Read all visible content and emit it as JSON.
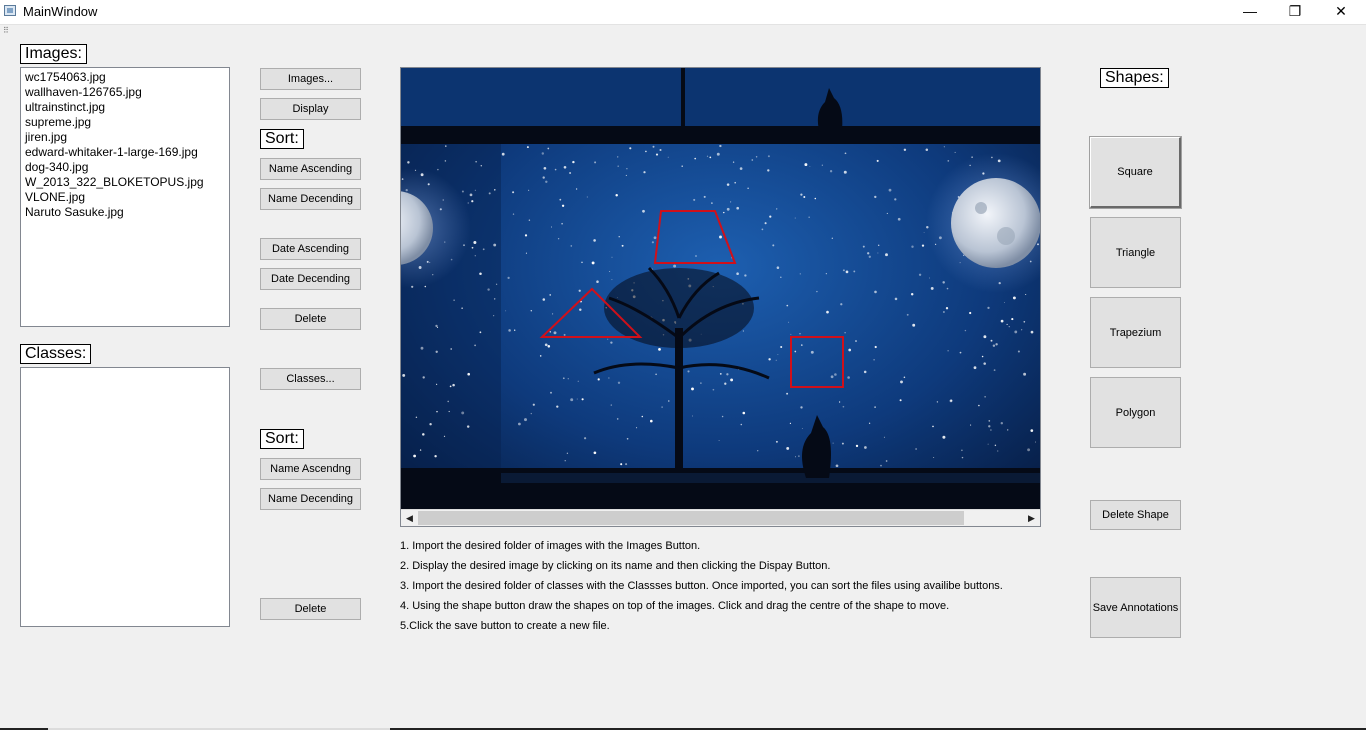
{
  "window": {
    "title": "MainWindow",
    "minimize": "—",
    "restore": "❐",
    "close": "✕",
    "grip": "⠿"
  },
  "images_panel": {
    "label": "Images:",
    "files": [
      "wc1754063.jpg",
      "wallhaven-126765.jpg",
      "ultrainstinct.jpg",
      "supreme.jpg",
      "jiren.jpg",
      "edward-whitaker-1-large-169.jpg",
      "dog-340.jpg",
      "W_2013_322_BLOKETOPUS.jpg",
      "VLONE.jpg",
      "Naruto Sasuke.jpg"
    ]
  },
  "classes_panel": {
    "label": "Classes:",
    "items": []
  },
  "image_buttons": {
    "images": "Images...",
    "display": "Display",
    "sort_label": "Sort:",
    "name_asc": "Name Ascending",
    "name_desc": "Name Decending",
    "date_asc": "Date Ascending",
    "date_desc": "Date Decending",
    "delete": "Delete"
  },
  "class_buttons": {
    "classes": "Classes...",
    "sort_label": "Sort:",
    "name_asc": "Name Ascendng",
    "name_desc": "Name Decending",
    "delete": "Delete"
  },
  "shapes_panel": {
    "label": "Shapes:",
    "square": "Square",
    "triangle": "Triangle",
    "trapezium": "Trapezium",
    "polygon": "Polygon",
    "delete_shape": "Delete Shape",
    "save_annotations": "Save Annotations"
  },
  "viewer": {
    "scroll_left": "◀",
    "scroll_right": "▶",
    "annotation_color": "#d0101a",
    "sky_color": "#0d3a7a"
  },
  "instructions": [
    "1. Import the desired folder of images with the Images Button.",
    "2. Display the desired image by clicking on its name and then clicking the Dispay Button.",
    "3. Import the desired folder of classes with the Classses button. Once imported, you can sort the files using availibe buttons.",
    "4. Using the shape button draw the shapes on top of the images. Click and drag the centre of the shape to move.",
    "5.Click the save button to create a new file."
  ]
}
